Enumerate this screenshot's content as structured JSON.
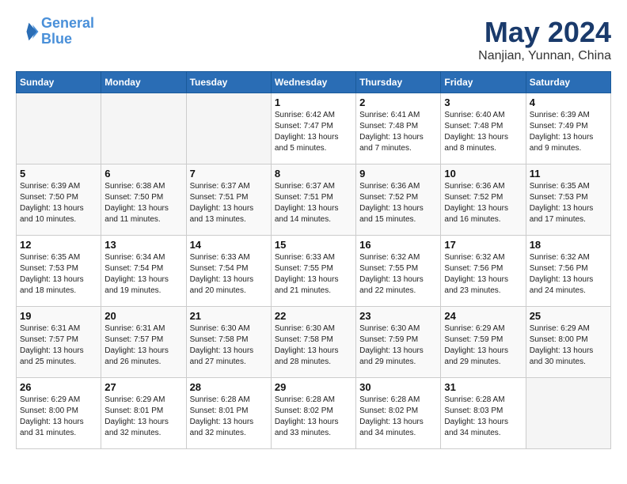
{
  "header": {
    "logo_line1": "General",
    "logo_line2": "Blue",
    "month": "May 2024",
    "location": "Nanjian, Yunnan, China"
  },
  "weekdays": [
    "Sunday",
    "Monday",
    "Tuesday",
    "Wednesday",
    "Thursday",
    "Friday",
    "Saturday"
  ],
  "weeks": [
    [
      {
        "day": "",
        "info": ""
      },
      {
        "day": "",
        "info": ""
      },
      {
        "day": "",
        "info": ""
      },
      {
        "day": "1",
        "info": "Sunrise: 6:42 AM\nSunset: 7:47 PM\nDaylight: 13 hours\nand 5 minutes."
      },
      {
        "day": "2",
        "info": "Sunrise: 6:41 AM\nSunset: 7:48 PM\nDaylight: 13 hours\nand 7 minutes."
      },
      {
        "day": "3",
        "info": "Sunrise: 6:40 AM\nSunset: 7:48 PM\nDaylight: 13 hours\nand 8 minutes."
      },
      {
        "day": "4",
        "info": "Sunrise: 6:39 AM\nSunset: 7:49 PM\nDaylight: 13 hours\nand 9 minutes."
      }
    ],
    [
      {
        "day": "5",
        "info": "Sunrise: 6:39 AM\nSunset: 7:50 PM\nDaylight: 13 hours\nand 10 minutes."
      },
      {
        "day": "6",
        "info": "Sunrise: 6:38 AM\nSunset: 7:50 PM\nDaylight: 13 hours\nand 11 minutes."
      },
      {
        "day": "7",
        "info": "Sunrise: 6:37 AM\nSunset: 7:51 PM\nDaylight: 13 hours\nand 13 minutes."
      },
      {
        "day": "8",
        "info": "Sunrise: 6:37 AM\nSunset: 7:51 PM\nDaylight: 13 hours\nand 14 minutes."
      },
      {
        "day": "9",
        "info": "Sunrise: 6:36 AM\nSunset: 7:52 PM\nDaylight: 13 hours\nand 15 minutes."
      },
      {
        "day": "10",
        "info": "Sunrise: 6:36 AM\nSunset: 7:52 PM\nDaylight: 13 hours\nand 16 minutes."
      },
      {
        "day": "11",
        "info": "Sunrise: 6:35 AM\nSunset: 7:53 PM\nDaylight: 13 hours\nand 17 minutes."
      }
    ],
    [
      {
        "day": "12",
        "info": "Sunrise: 6:35 AM\nSunset: 7:53 PM\nDaylight: 13 hours\nand 18 minutes."
      },
      {
        "day": "13",
        "info": "Sunrise: 6:34 AM\nSunset: 7:54 PM\nDaylight: 13 hours\nand 19 minutes."
      },
      {
        "day": "14",
        "info": "Sunrise: 6:33 AM\nSunset: 7:54 PM\nDaylight: 13 hours\nand 20 minutes."
      },
      {
        "day": "15",
        "info": "Sunrise: 6:33 AM\nSunset: 7:55 PM\nDaylight: 13 hours\nand 21 minutes."
      },
      {
        "day": "16",
        "info": "Sunrise: 6:32 AM\nSunset: 7:55 PM\nDaylight: 13 hours\nand 22 minutes."
      },
      {
        "day": "17",
        "info": "Sunrise: 6:32 AM\nSunset: 7:56 PM\nDaylight: 13 hours\nand 23 minutes."
      },
      {
        "day": "18",
        "info": "Sunrise: 6:32 AM\nSunset: 7:56 PM\nDaylight: 13 hours\nand 24 minutes."
      }
    ],
    [
      {
        "day": "19",
        "info": "Sunrise: 6:31 AM\nSunset: 7:57 PM\nDaylight: 13 hours\nand 25 minutes."
      },
      {
        "day": "20",
        "info": "Sunrise: 6:31 AM\nSunset: 7:57 PM\nDaylight: 13 hours\nand 26 minutes."
      },
      {
        "day": "21",
        "info": "Sunrise: 6:30 AM\nSunset: 7:58 PM\nDaylight: 13 hours\nand 27 minutes."
      },
      {
        "day": "22",
        "info": "Sunrise: 6:30 AM\nSunset: 7:58 PM\nDaylight: 13 hours\nand 28 minutes."
      },
      {
        "day": "23",
        "info": "Sunrise: 6:30 AM\nSunset: 7:59 PM\nDaylight: 13 hours\nand 29 minutes."
      },
      {
        "day": "24",
        "info": "Sunrise: 6:29 AM\nSunset: 7:59 PM\nDaylight: 13 hours\nand 29 minutes."
      },
      {
        "day": "25",
        "info": "Sunrise: 6:29 AM\nSunset: 8:00 PM\nDaylight: 13 hours\nand 30 minutes."
      }
    ],
    [
      {
        "day": "26",
        "info": "Sunrise: 6:29 AM\nSunset: 8:00 PM\nDaylight: 13 hours\nand 31 minutes."
      },
      {
        "day": "27",
        "info": "Sunrise: 6:29 AM\nSunset: 8:01 PM\nDaylight: 13 hours\nand 32 minutes."
      },
      {
        "day": "28",
        "info": "Sunrise: 6:28 AM\nSunset: 8:01 PM\nDaylight: 13 hours\nand 32 minutes."
      },
      {
        "day": "29",
        "info": "Sunrise: 6:28 AM\nSunset: 8:02 PM\nDaylight: 13 hours\nand 33 minutes."
      },
      {
        "day": "30",
        "info": "Sunrise: 6:28 AM\nSunset: 8:02 PM\nDaylight: 13 hours\nand 34 minutes."
      },
      {
        "day": "31",
        "info": "Sunrise: 6:28 AM\nSunset: 8:03 PM\nDaylight: 13 hours\nand 34 minutes."
      },
      {
        "day": "",
        "info": ""
      }
    ]
  ]
}
